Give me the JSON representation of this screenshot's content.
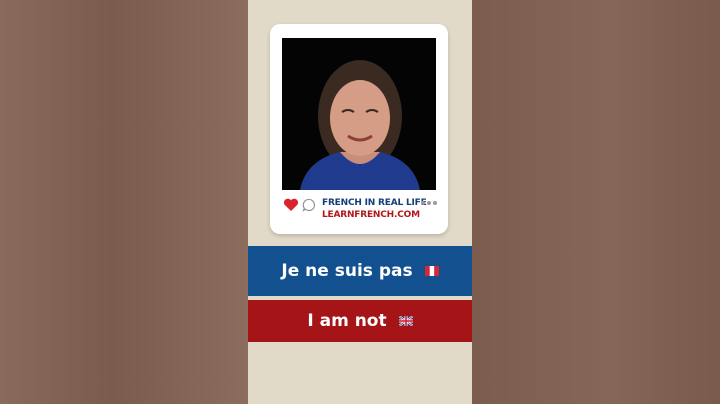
{
  "brand": {
    "line1": "FRENCH IN REAL LIFE",
    "line2": "LEARNFRENCH.COM"
  },
  "captions": {
    "french": "Je ne suis pas",
    "english": "I am not"
  },
  "icons": {
    "like": "heart-icon",
    "comment": "comment-icon",
    "more": "more-dots-icon",
    "french_flag": "french-flag-icon",
    "uk_flag": "uk-flag-icon"
  },
  "colors": {
    "blue_banner": "#12508f",
    "red_banner": "#a51416",
    "heart": "#d9232d",
    "brand_blue": "#153e74",
    "brand_red": "#b3161b",
    "stage_background": "#e2dac8"
  }
}
